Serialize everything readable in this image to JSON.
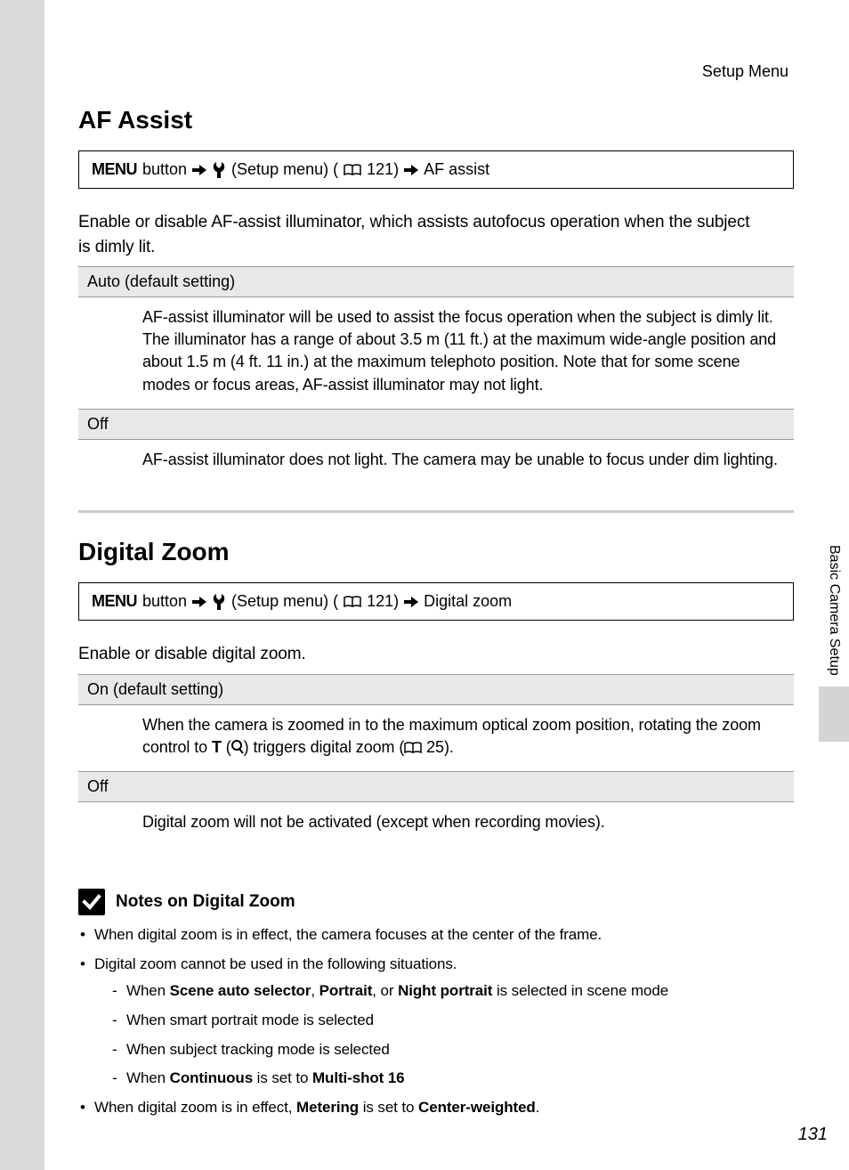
{
  "header": {
    "section_name": "Setup Menu"
  },
  "side_tab": {
    "label": "Basic Camera Setup"
  },
  "page_number": "131",
  "af_assist": {
    "heading": "AF Assist",
    "nav": {
      "menu_button": "MENU",
      "button_word": "button",
      "setup_text": "(Setup menu) (",
      "page_ref": " 121)",
      "target": "AF assist"
    },
    "intro": "Enable or disable AF-assist illuminator, which assists autofocus operation when the subject is dimly lit.",
    "options": [
      {
        "name": "Auto (default setting)",
        "desc": "AF-assist illuminator will be used to assist the focus operation when the subject is dimly lit. The illuminator has a range of about 3.5 m (11 ft.) at the maximum wide-angle position and about 1.5 m (4 ft. 11 in.) at the maximum telephoto position. Note that for some scene modes or focus areas, AF-assist illuminator may not light."
      },
      {
        "name": "Off",
        "desc": "AF-assist illuminator does not light. The camera may be unable to focus under dim lighting."
      }
    ]
  },
  "digital_zoom": {
    "heading": "Digital Zoom",
    "nav": {
      "menu_button": "MENU",
      "button_word": "button",
      "setup_text": "(Setup menu) (",
      "page_ref": " 121)",
      "target": "Digital zoom"
    },
    "intro": "Enable or disable digital zoom.",
    "options": [
      {
        "name": "On (default setting)",
        "desc_pre": "When the camera is zoomed in to the maximum optical zoom position, rotating the zoom control to ",
        "tele": "T",
        "desc_mid": " (",
        "desc_mid2": ") triggers digital zoom (",
        "ref": " 25).",
        "desc_post": ""
      },
      {
        "name": "Off",
        "desc": "Digital zoom will not be activated (except when recording movies)."
      }
    ],
    "notes": {
      "title": "Notes on Digital Zoom",
      "bullets": [
        {
          "text": "When digital zoom is in effect, the camera focuses at the center of the frame."
        },
        {
          "text": "Digital zoom cannot be used in the following situations.",
          "sub": [
            {
              "pre": "When ",
              "b1": "Scene auto selector",
              "mid1": ", ",
              "b2": "Portrait",
              "mid2": ", or ",
              "b3": "Night portrait",
              "post": " is selected in scene mode"
            },
            {
              "text": "When smart portrait mode is selected"
            },
            {
              "text": "When subject tracking mode is selected"
            },
            {
              "pre": "When ",
              "b1": "Continuous",
              "mid1": " is set to ",
              "b2": "Multi-shot 16",
              "post": ""
            }
          ]
        },
        {
          "pre": "When digital zoom is in effect, ",
          "b1": "Metering",
          "mid1": " is set to ",
          "b2": "Center-weighted",
          "post": "."
        }
      ]
    }
  }
}
